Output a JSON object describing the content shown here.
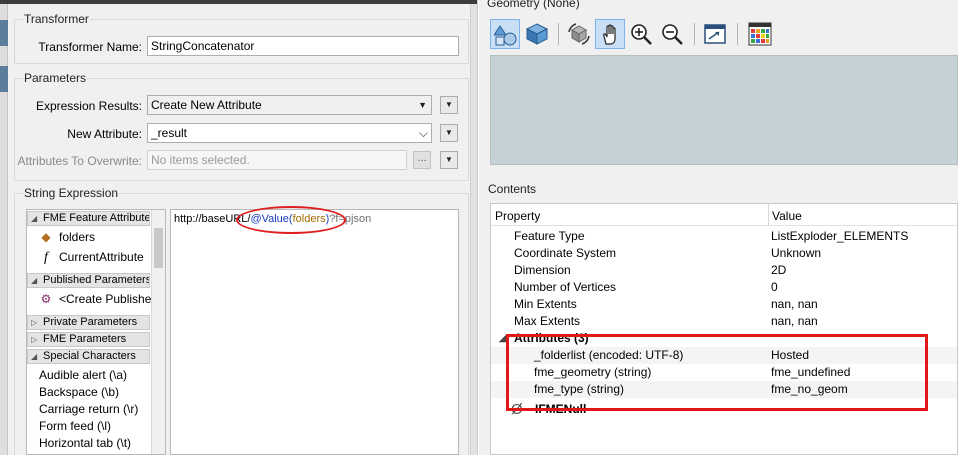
{
  "transformer": {
    "group_label": "Transformer",
    "name_label": "Transformer Name:",
    "name_value": "StringConcatenator"
  },
  "parameters": {
    "group_label": "Parameters",
    "expression_results_label": "Expression Results:",
    "expression_results_value": "Create New Attribute",
    "new_attribute_label": "New Attribute:",
    "new_attribute_value": "_result",
    "overwrite_label": "Attributes To Overwrite:",
    "overwrite_placeholder": "No items selected.",
    "overwrite_button_label": "..."
  },
  "string_expression": {
    "group_label": "String Expression",
    "tree": {
      "fme_feature_attributes": "FME Feature Attribute",
      "attribute_items": [
        {
          "label": "folders",
          "icon": "diamond-arrow-icon"
        },
        {
          "label": "CurrentAttribute",
          "icon": "function-icon"
        }
      ],
      "published_parameters": "Published Parameters",
      "create_published": "<Create Publishe",
      "private_parameters": "Private Parameters",
      "fme_parameters": "FME Parameters",
      "special_characters": "Special Characters",
      "special_items": [
        "Audible alert (\\a)",
        "Backspace (\\b)",
        "Carriage return (\\r)",
        "Form feed (\\l)",
        "Horizontal tab (\\t)"
      ]
    },
    "expression": {
      "prefix": "http://baseURL/",
      "function": "@Value(",
      "argument": "folders",
      "close": ")",
      "suffix": "?f=pjson"
    }
  },
  "geometry": {
    "title": "Geometry (None)",
    "toolbar": [
      {
        "name": "shapes-icon",
        "active": true
      },
      {
        "name": "cube-icon",
        "active": false
      },
      {
        "name": "rotate-icon",
        "active": false
      },
      {
        "name": "pan-hand-icon",
        "active": true
      },
      {
        "name": "zoom-in-icon",
        "active": false
      },
      {
        "name": "zoom-out-icon",
        "active": false
      },
      {
        "name": "zoom-extent-icon",
        "active": false
      },
      {
        "name": "color-grid-icon",
        "active": false
      }
    ]
  },
  "contents": {
    "title": "Contents",
    "columns": [
      "Property",
      "Value"
    ],
    "rows": [
      {
        "property": "Feature Type",
        "value": "ListExploder_ELEMENTS"
      },
      {
        "property": "Coordinate System",
        "value": "Unknown"
      },
      {
        "property": "Dimension",
        "value": "2D"
      },
      {
        "property": "Number of Vertices",
        "value": "0"
      },
      {
        "property": "Min Extents",
        "value": "nan, nan"
      },
      {
        "property": "Max Extents",
        "value": "nan, nan"
      }
    ],
    "attributes_header": "Attributes (3)",
    "attributes": [
      {
        "property": "_folderlist (encoded: UTF-8)",
        "value": "Hosted"
      },
      {
        "property": "fme_geometry (string)",
        "value": "fme_undefined"
      },
      {
        "property": "fme_type (string)",
        "value": "fme_no_geom"
      }
    ],
    "null_row": "IFMENull"
  },
  "colors": {
    "highlight_red": "#e01818",
    "function_blue": "#1a3dbf",
    "argument_gold": "#a36a00",
    "viewport": "#c5d2d5"
  }
}
